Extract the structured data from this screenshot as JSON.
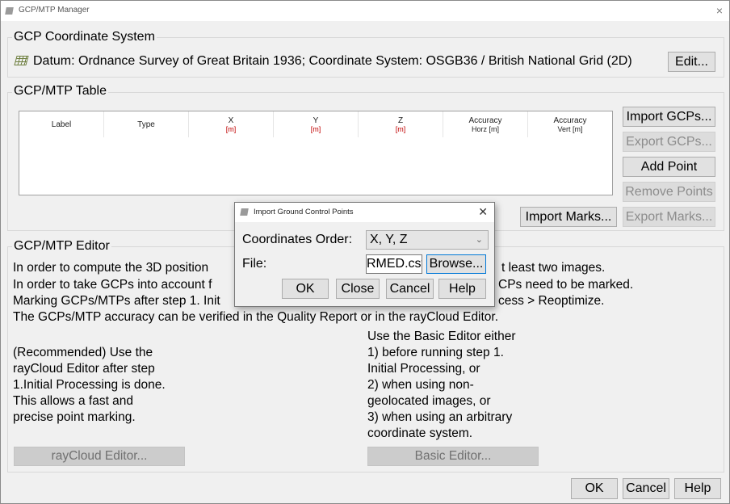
{
  "window": {
    "title": "GCP/MTP Manager",
    "close_glyph": "×"
  },
  "coord_system": {
    "group_label": "GCP Coordinate System",
    "datum_text": "Datum: Ordnance Survey of Great Britain 1936; Coordinate System: OSGB36 / British National Grid (2D)",
    "edit_label": "Edit..."
  },
  "table": {
    "group_label": "GCP/MTP Table",
    "columns": [
      {
        "name": "Label",
        "unit": ""
      },
      {
        "name": "Type",
        "unit": ""
      },
      {
        "name": "X",
        "unit": "[m]"
      },
      {
        "name": "Y",
        "unit": "[m]"
      },
      {
        "name": "Z",
        "unit": "[m]"
      },
      {
        "name": "Accuracy",
        "unit": "Horz [m]"
      },
      {
        "name": "Accuracy",
        "unit": "Vert [m]"
      }
    ],
    "buttons": {
      "import_gcps": "Import GCPs...",
      "export_gcps": "Export GCPs...",
      "add_point": "Add Point",
      "remove_points": "Remove Points",
      "import_marks": "Import Marks...",
      "export_marks": "Export Marks..."
    }
  },
  "editor": {
    "group_label": "GCP/MTP Editor",
    "lines": [
      "In order to compute the 3D position",
      "In order to take GCPs into account f",
      "Marking GCPs/MTPs after step 1. Init",
      "The GCPs/MTP accuracy can be verified in the Quality Report or in the rayCloud Editor."
    ],
    "lines_right": [
      "t least two images.",
      "CPs need to be marked.",
      "cess > Reoptimize."
    ],
    "left_note": [
      "(Recommended) Use the",
      "rayCloud Editor after step",
      "1.Initial Processing is done.",
      "This allows a fast and",
      "precise point marking."
    ],
    "right_note": [
      "Use the Basic Editor either",
      "1) before running step 1.",
      "Initial Processing, or",
      "2) when using non-",
      "geolocated images, or",
      "3) when using an arbitrary",
      "coordinate system."
    ],
    "raycloud_button": "rayCloud Editor...",
    "basic_button": "Basic Editor..."
  },
  "footer": {
    "ok": "OK",
    "cancel": "Cancel",
    "help": "Help"
  },
  "dialog": {
    "title": "Import Ground Control Points",
    "close_glyph": "✕",
    "coord_order_label": "Coordinates Order:",
    "coord_order_value": "X, Y, Z",
    "file_label": "File:",
    "file_value": "RMED.csv",
    "browse": "Browse...",
    "ok": "OK",
    "close": "Close",
    "cancel": "Cancel",
    "help": "Help"
  }
}
